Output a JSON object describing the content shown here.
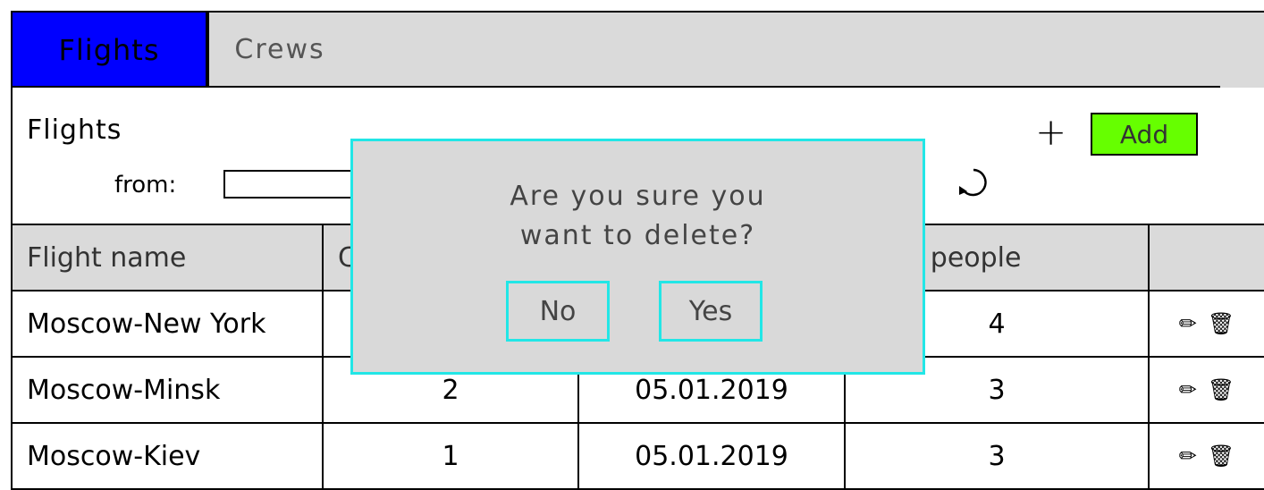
{
  "tabs": [
    {
      "label": "Flights",
      "active": true
    },
    {
      "label": "Crews",
      "active": false
    }
  ],
  "page": {
    "title": "Flights",
    "filter_label": "from:",
    "filter_value": "",
    "add_label": "Add",
    "plus_symbol": "+",
    "refresh_icon": "refresh-icon"
  },
  "table": {
    "headers": [
      "Flight name",
      "C",
      "",
      "er of people",
      ""
    ],
    "rows": [
      {
        "name": "Moscow-New York",
        "crew": "",
        "date": "",
        "people": "4"
      },
      {
        "name": "Moscow-Minsk",
        "crew": "2",
        "date": "05.01.2019",
        "people": "3"
      },
      {
        "name": "Moscow-Kiev",
        "crew": "1",
        "date": "05.01.2019",
        "people": "3"
      }
    ],
    "edit_icon": "✏",
    "delete_icon": "🗑"
  },
  "dialog": {
    "line1": "Are you sure you",
    "line2": "want to delete?",
    "no_label": "No",
    "yes_label": "Yes"
  },
  "colors": {
    "active_tab": "#0000ff",
    "add_button": "#66ff00",
    "dialog_border": "#22e6e6",
    "panel_gray": "#dadada"
  }
}
